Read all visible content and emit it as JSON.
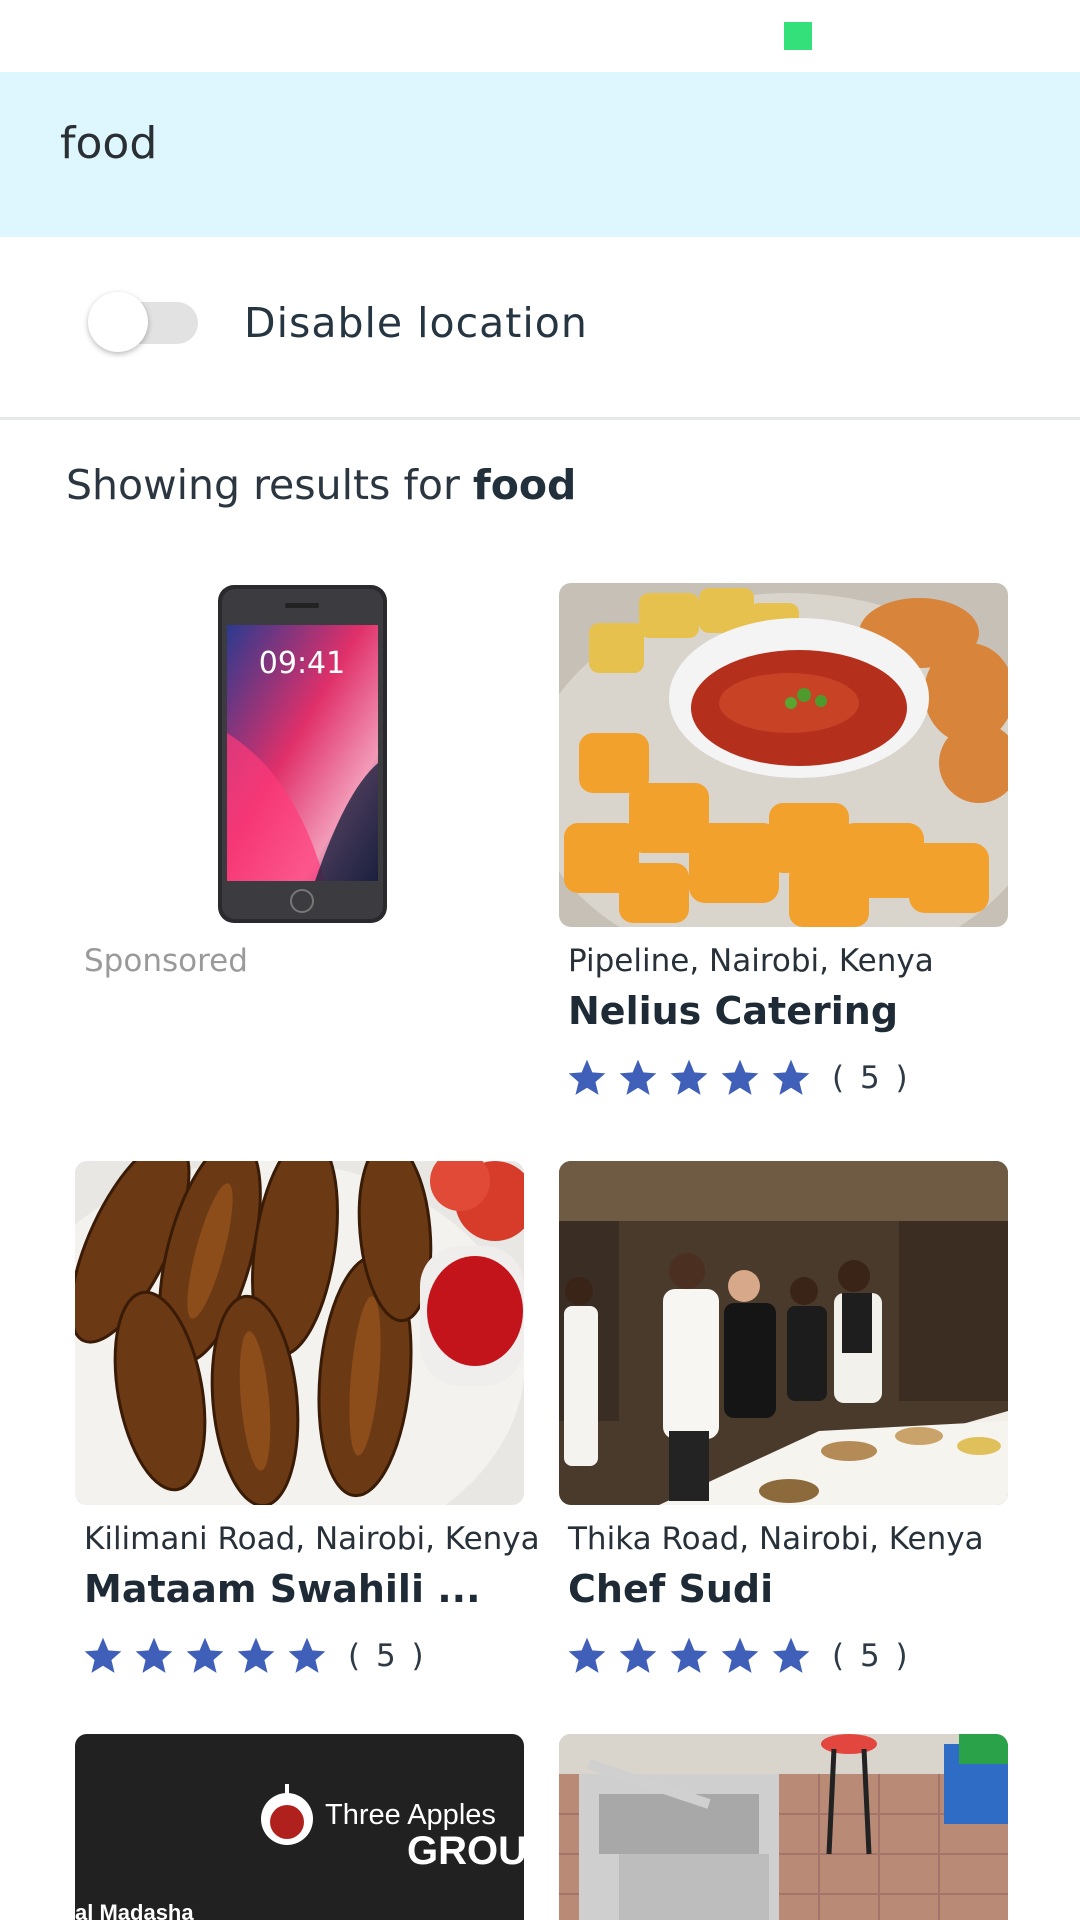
{
  "status_bar": {
    "indicator_color": "#33e07a"
  },
  "search": {
    "query": "food"
  },
  "location": {
    "toggle_label": "Disable location",
    "enabled": false
  },
  "results": {
    "prefix": "Showing results for ",
    "term": "food"
  },
  "cards": [
    {
      "type": "sponsored",
      "image": "iphone-ad-image",
      "label": "Sponsored"
    },
    {
      "type": "listing",
      "image": "fried-snacks-photo",
      "location": "Pipeline, Nairobi, Kenya",
      "name": "Nelius Catering",
      "rating": 5,
      "rating_count": "( 5 )"
    },
    {
      "type": "listing",
      "image": "fried-plantain-photo",
      "location": "Kilimani Road, Nairobi, Kenya",
      "name": "Mataam Swahili ...",
      "rating": 5,
      "rating_count": "( 5 )"
    },
    {
      "type": "listing",
      "image": "chefs-event-photo",
      "location": "Thika Road, Nairobi, Kenya",
      "name": "Chef Sudi",
      "rating": 5,
      "rating_count": "( 5 )"
    },
    {
      "type": "listing",
      "image": "three-apples-logo-photo",
      "logo_text": "Three Apples",
      "logo_subtext": "GROU",
      "logo_caption": "al Madasha"
    },
    {
      "type": "listing",
      "image": "kitchen-equipment-photo"
    }
  ],
  "colors": {
    "star": "#3f5fb8",
    "search_bg": "#def6fd"
  }
}
